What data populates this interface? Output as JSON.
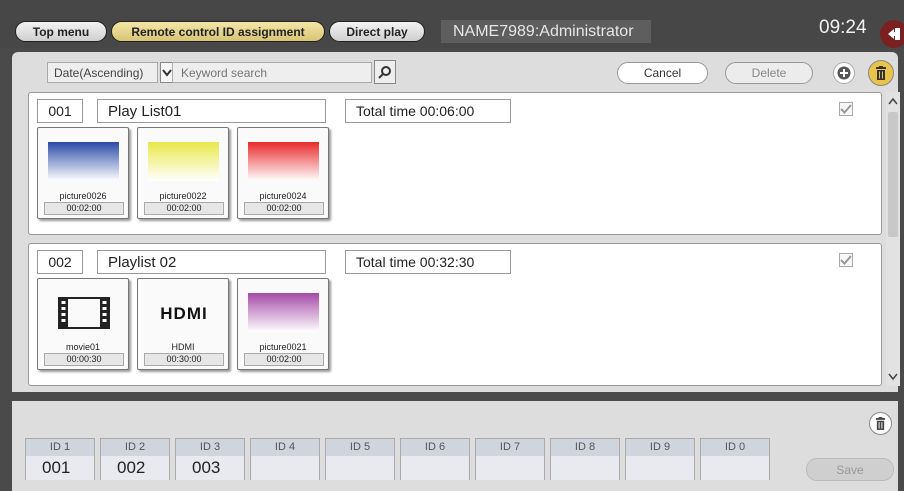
{
  "header": {
    "tabs": [
      {
        "label": "Top menu",
        "active": false
      },
      {
        "label": "Remote control ID assignment",
        "active": true
      },
      {
        "label": "Direct play",
        "active": false
      }
    ],
    "user": "NAME7989:Administrator",
    "clock": "09:24"
  },
  "toolbar": {
    "sort_selected": "Date(Ascending)",
    "search_placeholder": "Keyword search",
    "cancel_label": "Cancel",
    "delete_label": "Delete"
  },
  "playlists": [
    {
      "number": "001",
      "name": "Play List01",
      "total_time": "Total time 00:06:00",
      "checked": true,
      "items": [
        {
          "name": "picture0026",
          "time": "00:02:00",
          "kind": "blue-gradient-image"
        },
        {
          "name": "picture0022",
          "time": "00:02:00",
          "kind": "yellow-gradient-image"
        },
        {
          "name": "picture0024",
          "time": "00:02:00",
          "kind": "red-gradient-image"
        }
      ]
    },
    {
      "number": "002",
      "name": "Playlist 02",
      "total_time": "Total time 00:32:30",
      "checked": true,
      "items": [
        {
          "name": "movie01",
          "time": "00:00:30",
          "kind": "film-icon"
        },
        {
          "name": "HDMI",
          "time": "00:30:00",
          "kind": "hdmi-logo"
        },
        {
          "name": "picture0021",
          "time": "00:02:00",
          "kind": "purple-gradient-image"
        }
      ]
    }
  ],
  "hdmi_logo_text": "HDMI",
  "id_slots": [
    {
      "label": "ID 1",
      "value": "001"
    },
    {
      "label": "ID 2",
      "value": "002"
    },
    {
      "label": "ID 3",
      "value": "003"
    },
    {
      "label": "ID 4",
      "value": ""
    },
    {
      "label": "ID 5",
      "value": ""
    },
    {
      "label": "ID 6",
      "value": ""
    },
    {
      "label": "ID 7",
      "value": ""
    },
    {
      "label": "ID 8",
      "value": ""
    },
    {
      "label": "ID 9",
      "value": ""
    },
    {
      "label": "ID 0",
      "value": ""
    }
  ],
  "save_label": "Save",
  "colors": {
    "active_tab": "#e0cc7c",
    "accent_yellow": "#e8c44b",
    "logout_red": "#7a2020"
  }
}
